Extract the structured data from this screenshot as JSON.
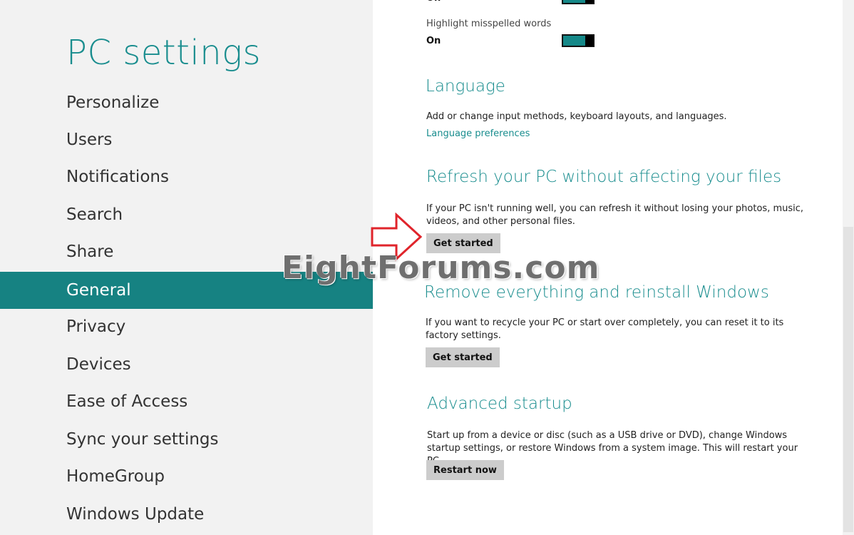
{
  "sidebar": {
    "title": "PC settings",
    "items": [
      {
        "label": "Personalize"
      },
      {
        "label": "Users"
      },
      {
        "label": "Notifications"
      },
      {
        "label": "Search"
      },
      {
        "label": "Share"
      },
      {
        "label": "General",
        "selected": true
      },
      {
        "label": "Privacy"
      },
      {
        "label": "Devices"
      },
      {
        "label": "Ease of Access"
      },
      {
        "label": "Sync your settings"
      },
      {
        "label": "HomeGroup"
      },
      {
        "label": "Windows Update"
      }
    ]
  },
  "spelling": {
    "autocorrect_value": "On",
    "highlight_label": "Highlight misspelled words",
    "highlight_value": "On"
  },
  "language": {
    "heading": "Language",
    "description": "Add or change input methods, keyboard layouts, and languages.",
    "link": "Language preferences"
  },
  "refresh": {
    "heading": "Refresh your PC without affecting your files",
    "description": "If your PC isn't running well, you can refresh it without losing your photos, music, videos, and other personal files.",
    "button": "Get started"
  },
  "reset": {
    "heading": "Remove everything and reinstall Windows",
    "description": "If you want to recycle your PC or start over completely, you can reset it to its factory settings.",
    "button": "Get started"
  },
  "advanced": {
    "heading": "Advanced startup",
    "description": "Start up from a device or disc (such as a USB drive or DVD), change Windows startup settings, or restore Windows from a system image. This will restart your PC.",
    "button": "Restart now"
  },
  "watermark": "EightForums.com",
  "colors": {
    "accent": "#198d8e",
    "selected_nav": "#168282",
    "sidebar_bg": "#f2f2f2",
    "button_bg": "#cccccc",
    "arrow": "#e0242b"
  }
}
